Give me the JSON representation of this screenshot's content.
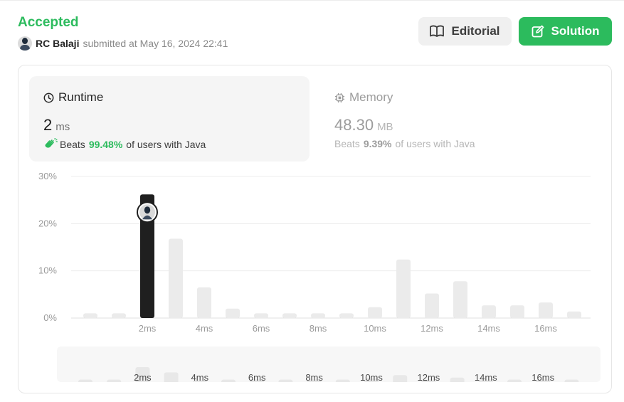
{
  "header": {
    "status": "Accepted",
    "user_name": "RC Balaji",
    "submitted_text": "submitted at May 16, 2024 22:41",
    "editorial_label": "Editorial",
    "solution_label": "Solution"
  },
  "runtime": {
    "title": "Runtime",
    "value": "2",
    "unit": "ms",
    "beats_label": "Beats",
    "beats_pct": "99.48%",
    "beats_suffix": "of users with Java"
  },
  "memory": {
    "title": "Memory",
    "value": "48.30",
    "unit": "MB",
    "beats_label": "Beats",
    "beats_pct": "9.39%",
    "beats_suffix": "of users with Java"
  },
  "colors": {
    "accent_green": "#2cbb5d",
    "selected_bar": "#1f1f1f",
    "bar": "#ebebeb"
  },
  "chart_data": {
    "type": "bar",
    "ylim": [
      0,
      30
    ],
    "y_ticks": [
      "30%",
      "20%",
      "10%",
      "0%"
    ],
    "y_tick_values": [
      30,
      20,
      10,
      0
    ],
    "x_tick_labels": [
      "2ms",
      "4ms",
      "6ms",
      "8ms",
      "10ms",
      "12ms",
      "14ms",
      "16ms"
    ],
    "x_tick_positions": [
      2,
      4,
      6,
      8,
      10,
      12,
      14,
      16
    ],
    "x": [
      0,
      1,
      2,
      3,
      4,
      5,
      6,
      7,
      8,
      9,
      10,
      11,
      12,
      13,
      14,
      15,
      16,
      17
    ],
    "values": [
      1.0,
      1.0,
      26.2,
      16.8,
      6.5,
      2.0,
      1.0,
      1.0,
      1.0,
      1.0,
      2.3,
      12.4,
      5.2,
      7.8,
      2.7,
      2.7,
      3.3,
      1.4
    ],
    "selected_x": 2,
    "mini_values": [
      1.0,
      1.0,
      6.0,
      3.9,
      0.8,
      1.0,
      1.0,
      1.0,
      1.0,
      1.0,
      1.5,
      2.8,
      1.0,
      1.8,
      1.0,
      1.0,
      1.0,
      1.0
    ],
    "mini_labels": [
      "2ms",
      "4ms",
      "6ms",
      "8ms",
      "10ms",
      "12ms",
      "14ms",
      "16ms"
    ]
  }
}
